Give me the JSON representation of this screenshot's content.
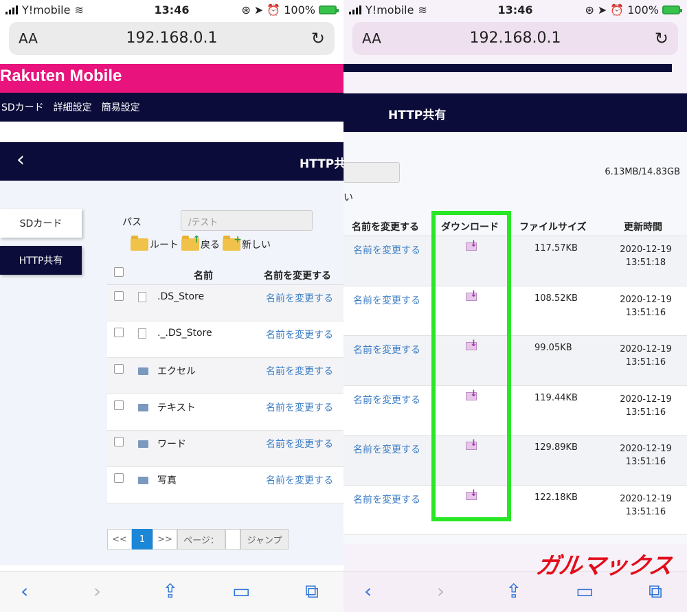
{
  "status": {
    "carrier": "Y!mobile",
    "time": "13:46",
    "battery": "100%"
  },
  "browser": {
    "text_size_label": "AA",
    "url": "192.168.0.1"
  },
  "left": {
    "brand": "Rakuten Mobile",
    "topnav": [
      "SDカード",
      "詳細設定",
      "簡易設定"
    ],
    "page_title": "HTTP共有",
    "sidebar": {
      "sd_card": "SDカード",
      "http_share": "HTTP共有"
    },
    "path_label": "パス",
    "path_value": "/テスト",
    "actions": {
      "root": "ルート",
      "back": "戻る",
      "new": "新しい"
    },
    "table": {
      "col_name": "名前",
      "col_rename": "名前を変更する",
      "rows": [
        {
          "name": ".DS_Store",
          "rename": "名前を変更する"
        },
        {
          "name": "._.DS_Store",
          "rename": "名前を変更する"
        },
        {
          "name": "エクセル",
          "rename": "名前を変更する"
        },
        {
          "name": "テキスト",
          "rename": "名前を変更する"
        },
        {
          "name": "ワード",
          "rename": "名前を変更する"
        },
        {
          "name": "写真",
          "rename": "名前を変更する"
        }
      ]
    },
    "pagination": {
      "prev": "<<",
      "current": "1",
      "next": ">>",
      "page_label": "ページ：",
      "jump": "ジャンプ"
    }
  },
  "right": {
    "page_title": "HTTP共有",
    "storage": "6.13MB/14.83GB",
    "fragment": "い",
    "table": {
      "col_rename": "名前を変更する",
      "col_download": "ダウンロード",
      "col_size": "ファイルサイズ",
      "col_updated": "更新時間",
      "rows": [
        {
          "rename": "名前を変更する",
          "size": "117.57KB",
          "updated": "2020-12-19 13:51:18"
        },
        {
          "rename": "名前を変更する",
          "size": "108.52KB",
          "updated": "2020-12-19 13:51:16"
        },
        {
          "rename": "名前を変更する",
          "size": "99.05KB",
          "updated": "2020-12-19 13:51:16"
        },
        {
          "rename": "名前を変更する",
          "size": "119.44KB",
          "updated": "2020-12-19 13:51:16"
        },
        {
          "rename": "名前を変更する",
          "size": "129.89KB",
          "updated": "2020-12-19 13:51:16"
        },
        {
          "rename": "名前を変更する",
          "size": "122.18KB",
          "updated": "2020-12-19 13:51:16"
        }
      ]
    },
    "highlight_color": "#29e626"
  },
  "watermark": "ガルマックス",
  "colors": {
    "brand": "#e8137d",
    "nav": "#0c0c3a",
    "link": "#3b7dc4",
    "pager_active": "#1c87d6"
  }
}
